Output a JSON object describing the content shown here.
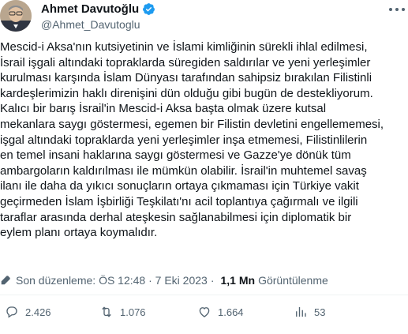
{
  "author": {
    "name": "Ahmet Davutoğlu",
    "handle": "@Ahmet_Davutoglu"
  },
  "tweet": {
    "lines": [
      "Mescid-i Aksa'nın kutsiyetinin ve İslami kimliğinin sürekli ihlal edilmesi,",
      "İsrail işgali altındaki topraklarda süregiden saldırılar ve yeni yerleşimler",
      "kurulması karşında İslam Dünyası tarafından sahipsiz bırakılan Filistinli",
      "kardeşlerimizin haklı direnişini dün olduğu gibi bugün de destekliyorum.",
      "Kalıcı bir barış İsrail'in Mescid-i Aksa başta olmak üzere kutsal",
      "mekanlara saygı göstermesi, egemen bir Filistin devletini engellememesi,",
      "işgal altındaki topraklarda yeni yerleşimler inşa etmemesi, Filistinlilerin",
      "en temel insani haklarına saygı göstermesi ve Gazze'ye dönük tüm",
      "ambargoların kaldırılması ile mümkün olabilir. İsrail'in muhtemel savaş",
      "ilanı ile daha da yıkıcı sonuçların ortaya çıkmaması için Türkiye vakit",
      "geçirmeden İslam İşbirliği Teşkilatı'nı acil toplantıya çağırmalı ve ilgili",
      "taraflar arasında derhal ateşkesin sağlanabilmesi için diplomatik bir",
      "eylem planı ortaya koymalıdır."
    ]
  },
  "meta": {
    "edited_label": "Son düzenleme: ÖS 12:48 · 7 Eki 2023",
    "separator": "·",
    "views_count": "1,1 Mn",
    "views_label": "Görüntülenme"
  },
  "actions": {
    "replies": "2.426",
    "retweets": "1.076",
    "likes": "1.664",
    "views": "53"
  },
  "colors": {
    "text": "#0f1419",
    "secondary": "#536471",
    "verified": "#1d9bf0",
    "divider": "#eff3f4"
  },
  "icons": [
    "avatar",
    "verified-badge-icon",
    "more-icon",
    "edit-clock-icon",
    "reply-icon",
    "retweet-icon",
    "like-icon",
    "views-icon"
  ]
}
